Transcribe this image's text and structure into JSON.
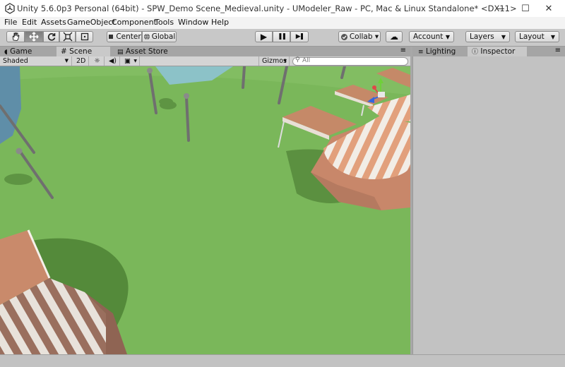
{
  "window": {
    "title": "Unity 5.6.0p3 Personal (64bit) - SPW_Demo Scene_Medieval.unity - UModeler_Raw - PC, Mac & Linux Standalone* <DX11>",
    "minimize": "—",
    "maximize": "☐",
    "close": "✕"
  },
  "menu": [
    "File",
    "Edit",
    "Assets",
    "GameObject",
    "Component",
    "Tools",
    "Window",
    "Help"
  ],
  "toolbar": {
    "tools": [
      "hand-icon",
      "move-icon",
      "rotate-icon",
      "scale-icon",
      "rect-icon"
    ],
    "pivot": "Center",
    "space": "Global",
    "play": "▶",
    "pause": "❚❚",
    "step": "▶❚",
    "collab": "Collab ▾",
    "cloud": "☁",
    "account": "Account",
    "layers": "Layers",
    "layout": "Layout"
  },
  "tabs": {
    "left": [
      "Game",
      "Scene",
      "Asset Store"
    ],
    "selected_left": "Scene",
    "right": [
      "Lighting",
      "Inspector"
    ],
    "selected_right": "Inspector",
    "menu_glyph": "≡"
  },
  "scene_toolbar": {
    "shading": "Shaded",
    "mode_2d": "2D",
    "gizmos": "Gizmos",
    "search_placeholder": "All"
  },
  "colors": {
    "ground": "#7ab75a",
    "sky": "#8cc469",
    "tent_orange": "#e5a784",
    "tent_white": "#f4efe9",
    "roof": "#b97d5e",
    "pole": "#6f6f6f"
  }
}
